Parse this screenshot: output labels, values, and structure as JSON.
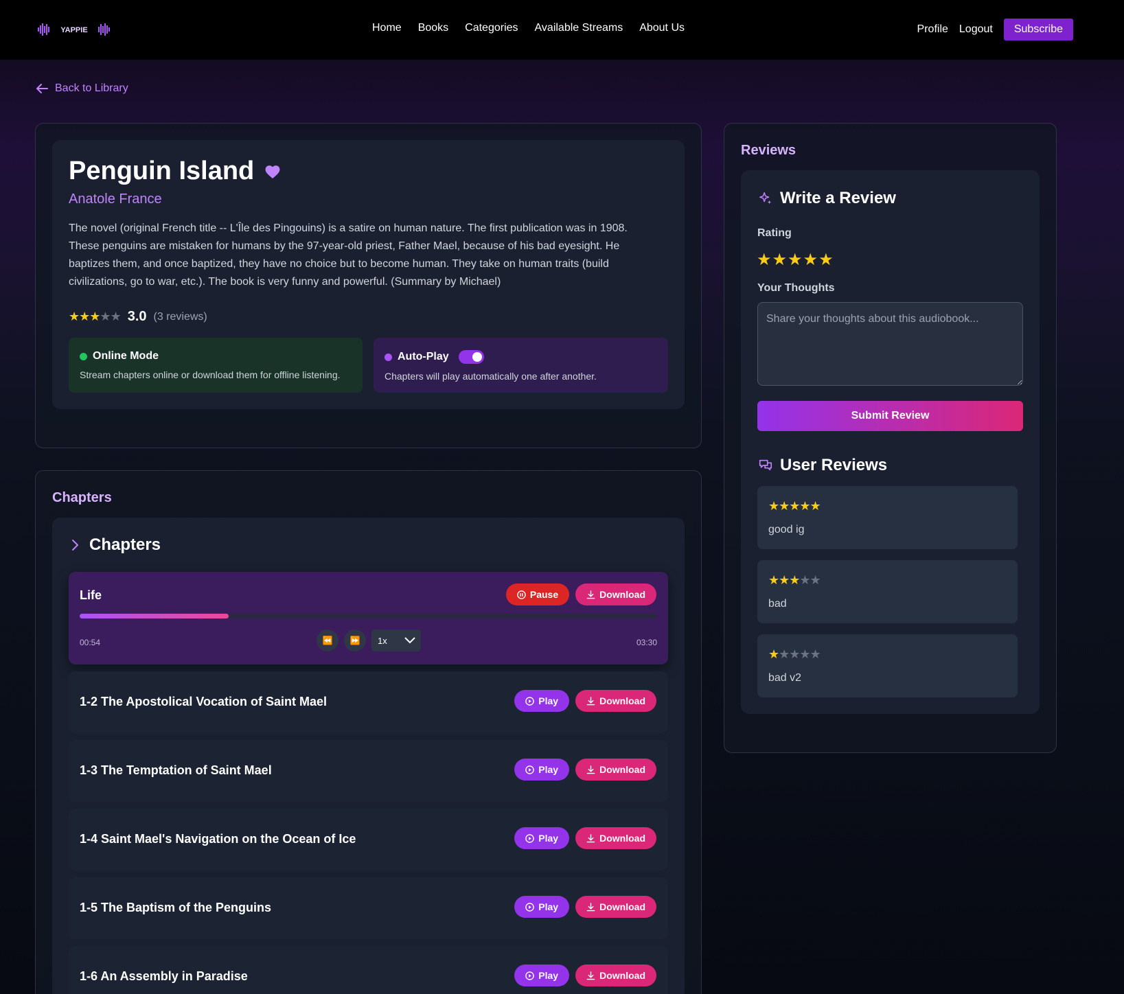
{
  "nav": {
    "logo_text": "YAPPIE",
    "links": [
      "Home",
      "Books",
      "Categories",
      "Available Streams",
      "About Us"
    ],
    "profile": "Profile",
    "logout": "Logout",
    "subscribe": "Subscribe"
  },
  "back_label": "Back to Library",
  "book": {
    "title": "Penguin Island",
    "author": "Anatole France",
    "description": "The novel (original French title -- L'Île des Pingouins) is a satire on human nature. The first publication was in 1908. These penguins are mistaken for humans by the 97-year-old priest, Father Mael, because of his bad eyesight. He baptizes them, and once baptized, they have no choice but to become human. They take on human traits (build civilizations, go to war, etc.). The book is very funny and powerful. (Summary by Michael)",
    "rating_stars": 3,
    "rating_value": "3.0",
    "review_count": "(3 reviews)"
  },
  "online_mode": {
    "title": "Online Mode",
    "subtitle": "Stream chapters online or download them for offline listening.",
    "color": "#22c55e"
  },
  "auto_play": {
    "title": "Auto-Play",
    "subtitle": "Chapters will play automatically one after another.",
    "enabled": true,
    "color": "#a855f7"
  },
  "chapters_section_title": "Chapters",
  "chapters_header": "Chapters",
  "now_playing": {
    "title": "Life",
    "pause_label": "Pause",
    "download_label": "Download",
    "progress": 0.258,
    "current_time": "00:54",
    "total_time": "03:30",
    "speed": "1x"
  },
  "chapters": [
    {
      "title": "1-2 The Apostolical Vocation of Saint Mael",
      "play": "Play",
      "download": "Download"
    },
    {
      "title": "1-3 The Temptation of Saint Mael",
      "play": "Play",
      "download": "Download"
    },
    {
      "title": "1-4 Saint Mael's Navigation on the Ocean of Ice",
      "play": "Play",
      "download": "Download"
    },
    {
      "title": "1-5 The Baptism of the Penguins",
      "play": "Play",
      "download": "Download"
    },
    {
      "title": "1-6 An Assembly in Paradise",
      "play": "Play",
      "download": "Download"
    }
  ],
  "reviews": {
    "section_title": "Reviews",
    "write_title": "Write a Review",
    "rating_label": "Rating",
    "rating_selected": 5,
    "thoughts_label": "Your Thoughts",
    "thoughts_placeholder": "Share your thoughts about this audiobook...",
    "submit_label": "Submit Review",
    "user_reviews_title": "User Reviews",
    "items": [
      {
        "stars": 5,
        "text": "good ig"
      },
      {
        "stars": 3,
        "text": "bad"
      },
      {
        "stars": 1,
        "text": "bad v2"
      }
    ]
  },
  "colors": {
    "accent_purple": "#9333ea",
    "accent_pink": "#db2777",
    "star": "#facc15",
    "pause_red": "#dc2626"
  }
}
